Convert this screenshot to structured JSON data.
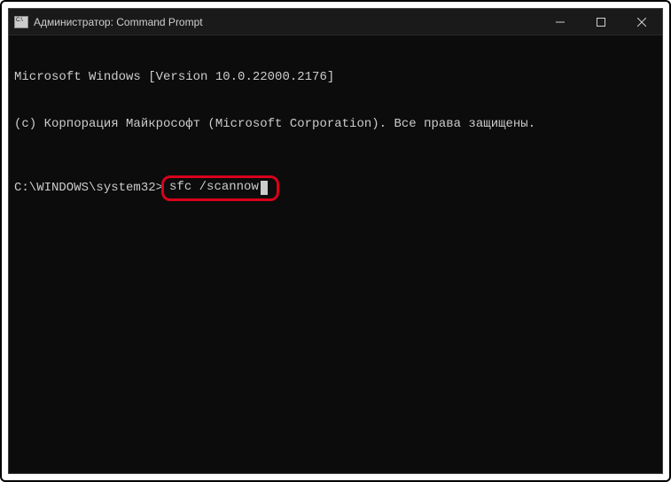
{
  "titlebar": {
    "title": "Администратор: Command Prompt"
  },
  "terminal": {
    "line1": "Microsoft Windows [Version 10.0.22000.2176]",
    "line2": "(c) Корпорация Майкрософт (Microsoft Corporation). Все права защищены.",
    "prompt": "C:\\WINDOWS\\system32>",
    "command": "sfc /scannow"
  }
}
